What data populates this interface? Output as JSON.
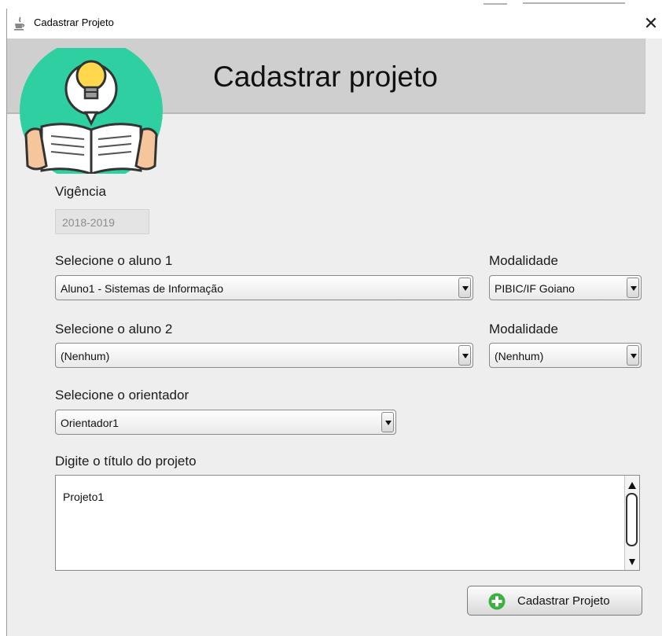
{
  "window": {
    "title": "Cadastrar Projeto",
    "close_glyph": "✕",
    "app_icon": "java-cup-icon"
  },
  "header": {
    "title": "Cadastrar projeto",
    "logo": "lightbulb-book-icon"
  },
  "form": {
    "vigencia": {
      "label": "Vigência",
      "value": "2018-2019"
    },
    "aluno1": {
      "label": "Selecione o aluno 1",
      "value": "Aluno1  - Sistemas de Informação"
    },
    "modalidade1": {
      "label": "Modalidade",
      "value": "PIBIC/IF Goiano"
    },
    "aluno2": {
      "label": "Selecione o aluno 2",
      "value": "(Nenhum)"
    },
    "modalidade2": {
      "label": "Modalidade",
      "value": "(Nenhum)"
    },
    "orientador": {
      "label": "Selecione o orientador",
      "value": "Orientador1"
    },
    "titulo": {
      "label": "Digite o título do projeto",
      "value": "Projeto1"
    }
  },
  "actions": {
    "submit_label": "Cadastrar Projeto",
    "submit_icon": "plus-circle-icon"
  },
  "colors": {
    "logo_teal": "#2ecfa0",
    "plus_green": "#3cb043",
    "header_band": "#cfcfcf"
  }
}
